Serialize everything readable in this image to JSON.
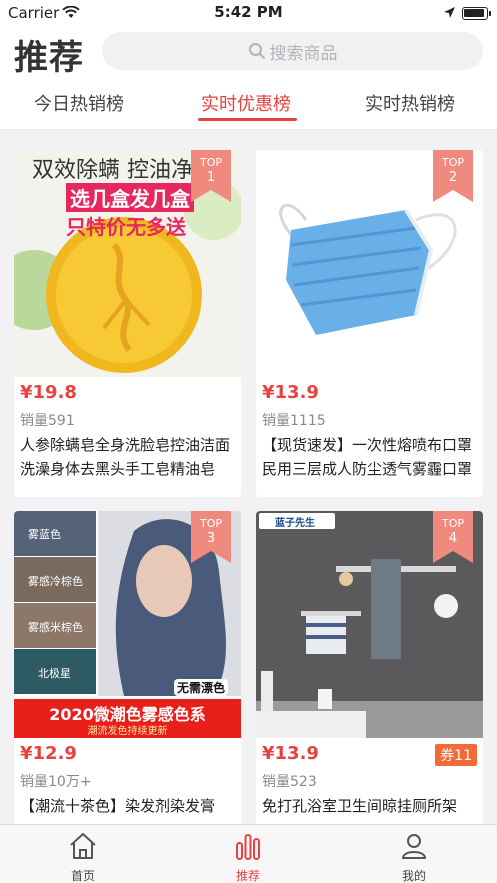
{
  "status_bar": {
    "carrier": "Carrier",
    "time": "5:42 PM"
  },
  "header": {
    "title": "推荐",
    "search_placeholder": "搜索商品"
  },
  "tabs": [
    {
      "label": "今日热销榜",
      "active": false
    },
    {
      "label": "实时优惠榜",
      "active": true
    },
    {
      "label": "实时热销榜",
      "active": false
    }
  ],
  "rank_badge_label": "TOP",
  "products": [
    {
      "rank": "1",
      "price": "¥19.8",
      "sales": "销量591",
      "title": "人参除螨皂全身洗脸皂控油洁面洗澡身体去黑头手工皂精油皂",
      "image_text": {
        "line1": "双效除螨 控油净痘",
        "line2": "选几盒发几盒",
        "line3": "只特价无多送"
      },
      "coupon": null
    },
    {
      "rank": "2",
      "price": "¥13.9",
      "sales": "销量1115",
      "title": "【现货速发】一次性熔喷布口罩民用三层成人防尘透气雾霾口罩",
      "image_text": null,
      "coupon": null
    },
    {
      "rank": "3",
      "price": "¥12.9",
      "sales": "销量10万+",
      "title": "【潮流十茶色】染发剂染发膏",
      "image_text": {
        "swatches": [
          "雾蓝色",
          "雾感冷棕色",
          "雾感米棕色",
          "北极星"
        ],
        "tag": "无需漂色",
        "banner": "2020微潮色雾感色系",
        "subbanner": "潮流发色持续更新"
      },
      "coupon": null
    },
    {
      "rank": "4",
      "price": "¥13.9",
      "sales": "销量523",
      "title": "免打孔浴室卫生间晾挂厕所架",
      "image_text": {
        "brand": "蓝子先生"
      },
      "coupon": "券11"
    }
  ],
  "tabbar": [
    {
      "label": "首页",
      "icon": "home-icon",
      "active": false
    },
    {
      "label": "推荐",
      "icon": "ranking-icon",
      "active": true
    },
    {
      "label": "我的",
      "icon": "profile-icon",
      "active": false
    }
  ],
  "colors": {
    "accent": "#e64340",
    "badge": "#f08a7e",
    "coupon": "#f26a36"
  }
}
